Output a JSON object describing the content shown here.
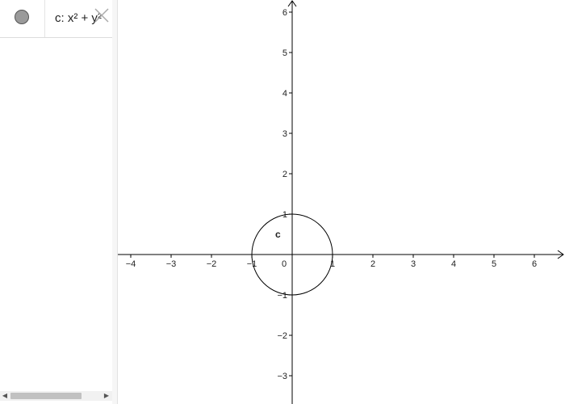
{
  "algebra": {
    "equation": "c: x² + y²",
    "object_color": "#9a9a9a"
  },
  "graphics": {
    "x_ticks": [
      "−4",
      "−3",
      "−2",
      "−1",
      "0",
      "1",
      "2",
      "3",
      "4",
      "5",
      "6"
    ],
    "y_ticks": [
      "6",
      "5",
      "4",
      "3",
      "2",
      "1",
      "−1",
      "−2",
      "−3"
    ],
    "object_label": "c",
    "axis_color": "#000000"
  },
  "chart_data": {
    "type": "scatter",
    "x_range": [
      -4.3,
      6.7
    ],
    "y_range": [
      -3.7,
      6.3
    ],
    "grid": false,
    "objects": [
      {
        "name": "c",
        "kind": "circle",
        "center": [
          0,
          0
        ],
        "radius": 1
      }
    ]
  }
}
